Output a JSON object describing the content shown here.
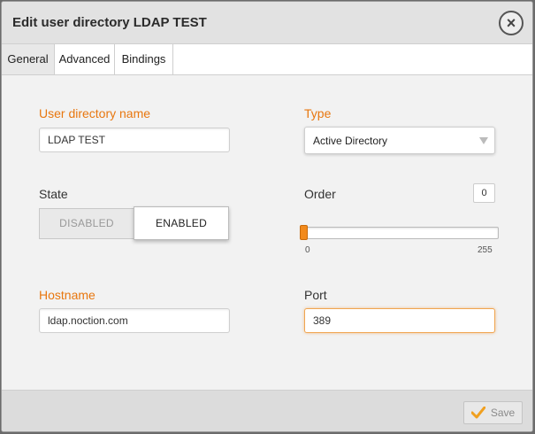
{
  "dialog": {
    "title": "Edit user directory LDAP TEST",
    "close_icon": "×"
  },
  "tabs": [
    {
      "label": "General",
      "active": true
    },
    {
      "label": "Advanced",
      "active": false
    },
    {
      "label": "Bindings",
      "active": false
    }
  ],
  "form": {
    "directory_name": {
      "label": "User directory name",
      "value": "LDAP TEST"
    },
    "type": {
      "label": "Type",
      "value": "Active Directory"
    },
    "state": {
      "label": "State",
      "options": [
        "DISABLED",
        "ENABLED"
      ],
      "selected": "ENABLED"
    },
    "order": {
      "label": "Order",
      "value": "0",
      "min": "0",
      "max": "255"
    },
    "hostname": {
      "label": "Hostname",
      "value": "ldap.noction.com"
    },
    "port": {
      "label": "Port",
      "value": "389"
    }
  },
  "footer": {
    "save_label": "Save"
  },
  "colors": {
    "accent": "#e8770f",
    "slider_handle": "#f28a1c",
    "check": "#f0a020"
  }
}
